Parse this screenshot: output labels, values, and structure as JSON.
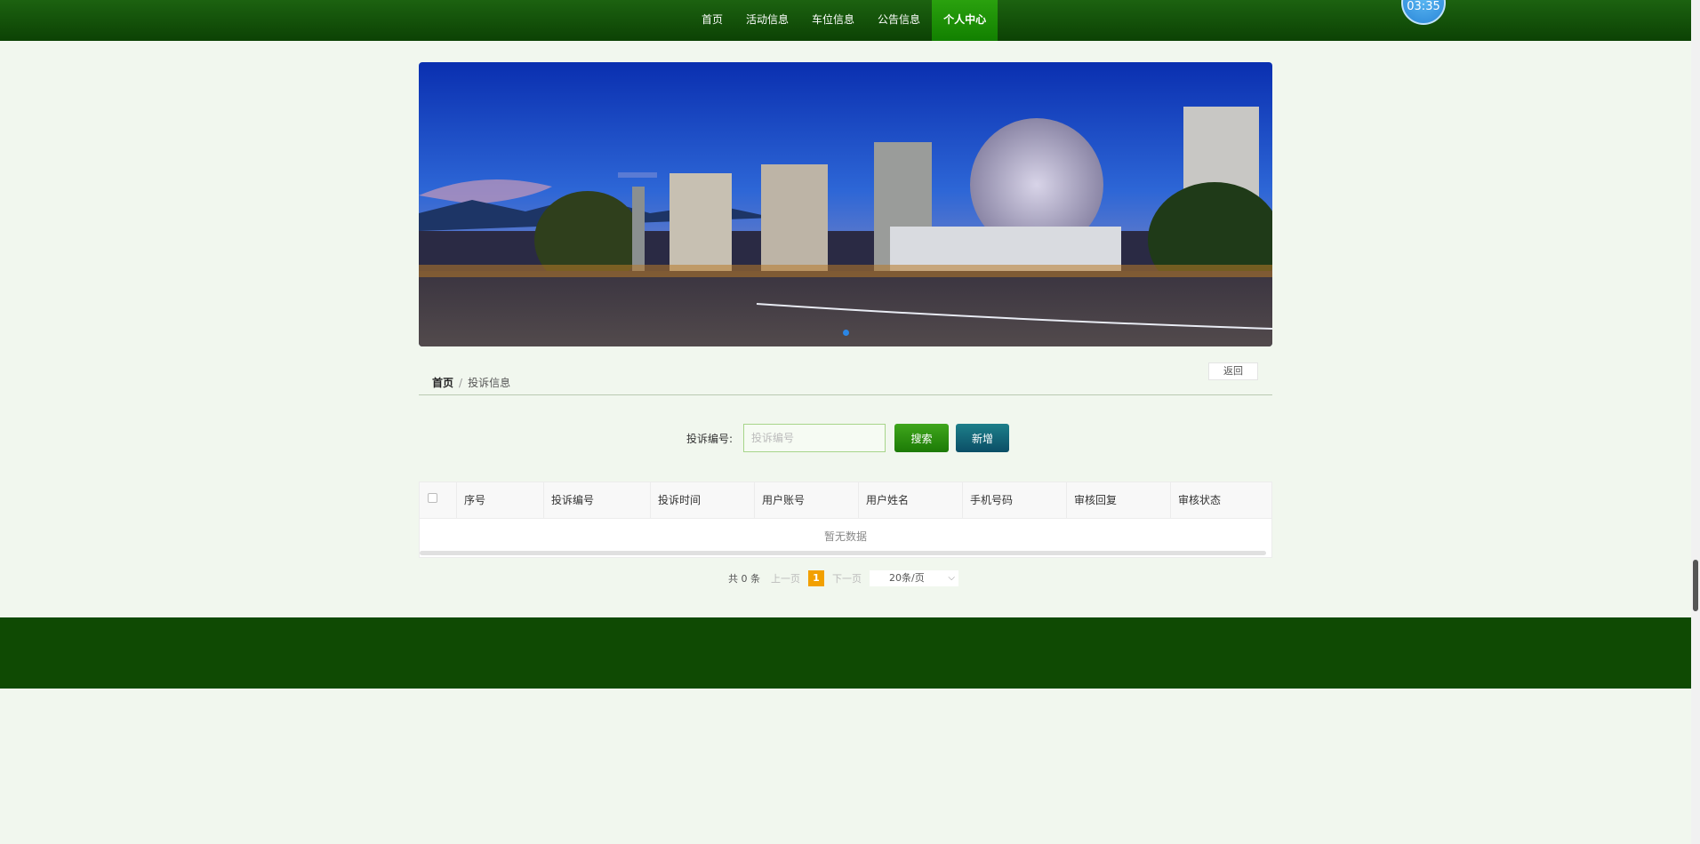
{
  "nav": {
    "items": [
      {
        "label": "首页"
      },
      {
        "label": "活动信息"
      },
      {
        "label": "车位信息"
      },
      {
        "label": "公告信息"
      },
      {
        "label": "个人中心",
        "active": true
      }
    ],
    "clock": "03:35"
  },
  "breadcrumb": {
    "home": "首页",
    "separator": "/",
    "current": "投诉信息"
  },
  "back_label": "返回",
  "search": {
    "label": "投诉编号:",
    "placeholder": "投诉编号",
    "value": "",
    "search_label": "搜索",
    "add_label": "新增"
  },
  "table": {
    "columns": [
      "序号",
      "投诉编号",
      "投诉时间",
      "用户账号",
      "用户姓名",
      "手机号码",
      "审核回复",
      "审核状态"
    ],
    "rows": [],
    "empty_text": "暂无数据"
  },
  "pagination": {
    "total": "共 0 条",
    "prev": "上一页",
    "page": "1",
    "next": "下一页",
    "page_size": "20条/页"
  },
  "colors": {
    "nav": "#0c4204",
    "nav_active": "#128000",
    "footer": "#0f4a03",
    "search_button": "#1c7a06",
    "add_button": "#0b4e66",
    "current_page": "#f2a000"
  }
}
